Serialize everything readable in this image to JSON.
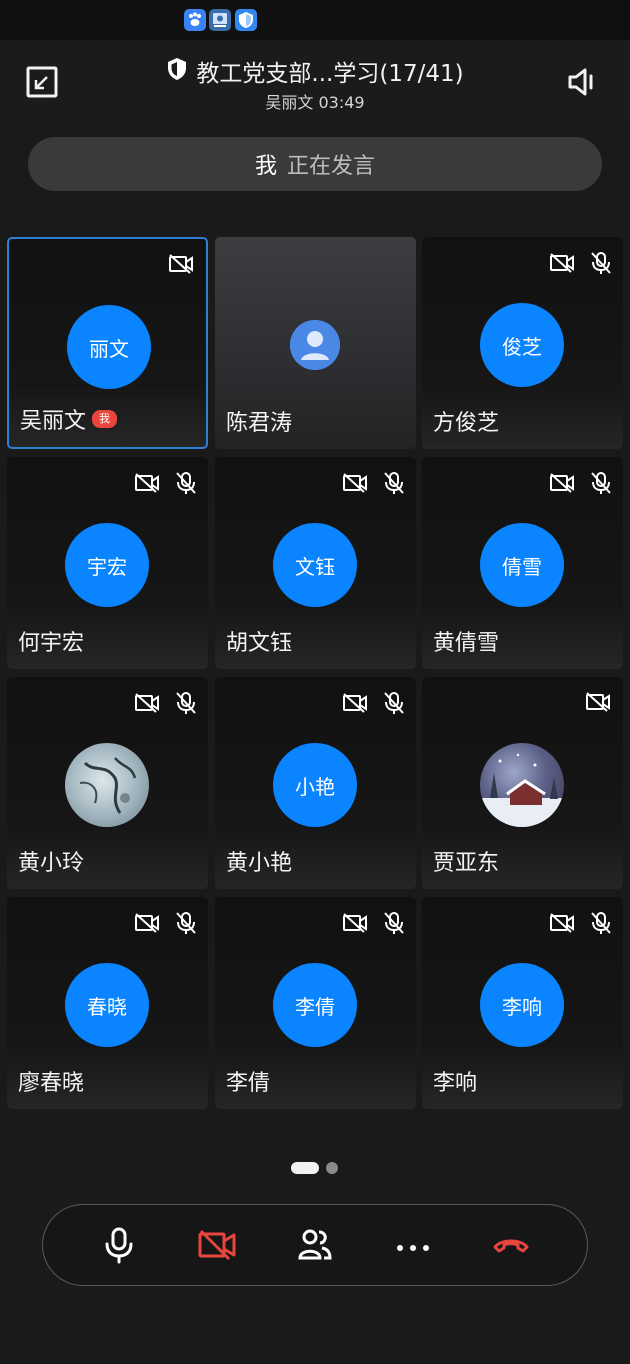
{
  "status_bar": {
    "icons": [
      "baidu-paw-icon",
      "app-badge-icon",
      "shield-app-icon"
    ]
  },
  "header": {
    "title": "教工党支部...学习(17/41)",
    "subtitle": "吴丽文 03:49",
    "icons": {
      "left": "exit-fullscreen-icon",
      "right": "speaker-icon",
      "title": "shield-check-icon"
    }
  },
  "speaking": {
    "name": "我",
    "status": "正在发言"
  },
  "participants": [
    {
      "name": "吴丽文",
      "avatar_text": "丽文",
      "avatar_type": "initials",
      "camera_off": true,
      "mic_muted": false,
      "is_me": true,
      "me_badge": "我",
      "active": true
    },
    {
      "name": "陈君涛",
      "avatar_text": "",
      "avatar_type": "default",
      "camera_off": false,
      "mic_muted": false
    },
    {
      "name": "方俊芝",
      "avatar_text": "俊芝",
      "avatar_type": "initials",
      "camera_off": true,
      "mic_muted": true
    },
    {
      "name": "何宇宏",
      "avatar_text": "宇宏",
      "avatar_type": "initials",
      "camera_off": true,
      "mic_muted": true
    },
    {
      "name": "胡文钰",
      "avatar_text": "文钰",
      "avatar_type": "initials",
      "camera_off": true,
      "mic_muted": true
    },
    {
      "name": "黄倩雪",
      "avatar_text": "倩雪",
      "avatar_type": "initials",
      "camera_off": true,
      "mic_muted": true
    },
    {
      "name": "黄小玲",
      "avatar_text": "",
      "avatar_type": "photo-ink",
      "camera_off": true,
      "mic_muted": true
    },
    {
      "name": "黄小艳",
      "avatar_text": "小艳",
      "avatar_type": "initials",
      "camera_off": true,
      "mic_muted": true
    },
    {
      "name": "贾亚东",
      "avatar_text": "",
      "avatar_type": "photo-snow",
      "camera_off": true,
      "mic_muted": false
    },
    {
      "name": "廖春晓",
      "avatar_text": "春晓",
      "avatar_type": "initials",
      "camera_off": true,
      "mic_muted": true
    },
    {
      "name": "李倩",
      "avatar_text": "李倩",
      "avatar_type": "initials",
      "camera_off": true,
      "mic_muted": true
    },
    {
      "name": "李响",
      "avatar_text": "李响",
      "avatar_type": "initials",
      "camera_off": true,
      "mic_muted": true
    }
  ],
  "pager": {
    "pages": 2,
    "current": 1
  },
  "controls": [
    {
      "name": "mic-button",
      "icon": "microphone-icon"
    },
    {
      "name": "camera-button",
      "icon": "camera-off-icon",
      "color": "#e8453c"
    },
    {
      "name": "participants-button",
      "icon": "participants-icon"
    },
    {
      "name": "more-button",
      "icon": "more-icon"
    },
    {
      "name": "hangup-button",
      "icon": "hangup-icon",
      "color": "#e8453c"
    }
  ],
  "colors": {
    "accent": "#0a84ff",
    "active_border": "#2f7ed8",
    "danger": "#e8453c",
    "background": "#1a1a1a"
  }
}
